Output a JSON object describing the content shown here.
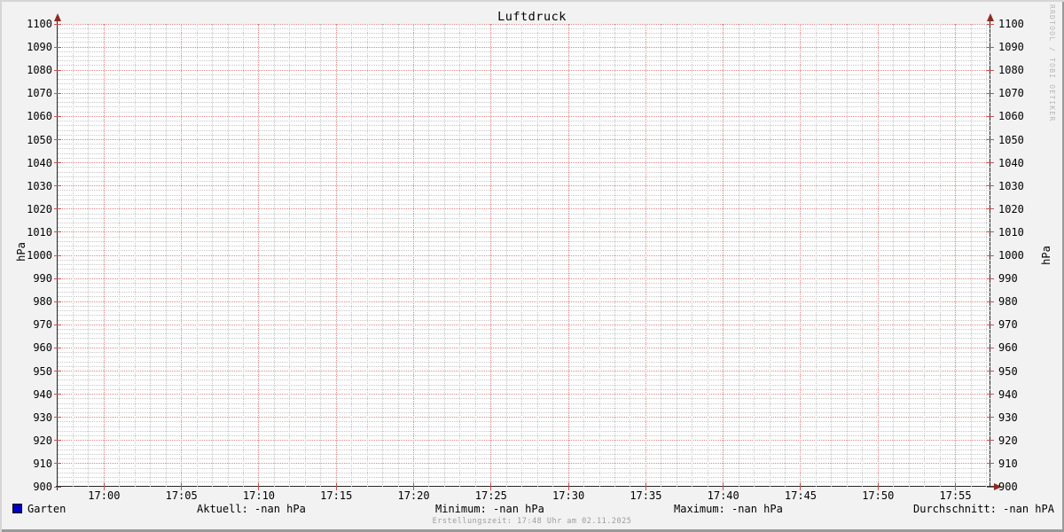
{
  "header": {
    "title": "Luftdruck"
  },
  "watermark": "RRDTOOL / TOBI OETIKER",
  "axes": {
    "left_unit": "hPa",
    "right_unit": "hPa"
  },
  "legend": {
    "series": {
      "label": "Garten",
      "color": "#0000c8"
    },
    "stats": [
      {
        "text": "Aktuell: -nan hPa"
      },
      {
        "text": "Minimum: -nan hPa"
      },
      {
        "text": "Maximum: -nan hPa"
      },
      {
        "text": "Durchschnitt: -nan hPA"
      }
    ]
  },
  "footer": {
    "text": "Erstellungszeit: 17:48 Uhr am 02.11.2025"
  },
  "chart_data": {
    "type": "line",
    "title": "Luftdruck",
    "xlabel": "",
    "ylabel": "hPa",
    "ylabel_right": "hPa",
    "ylim": [
      900,
      1100
    ],
    "y_major_step": 10,
    "y_minor_step": 2,
    "y_tick_labels": [
      "1100",
      "1090",
      "1080",
      "1070",
      "1060",
      "1050",
      "1040",
      "1030",
      "1020",
      "1010",
      "1000",
      "990",
      "980",
      "970",
      "960",
      "950",
      "940",
      "930",
      "920",
      "910",
      "900"
    ],
    "x_tick_labels": [
      "17:00",
      "17:05",
      "17:10",
      "17:15",
      "17:20",
      "17:25",
      "17:30",
      "17:35",
      "17:40",
      "17:45",
      "17:50",
      "17:55"
    ],
    "x_axis_start": "16:57",
    "x_major_step_min": 5,
    "x_minor_step_min": 1,
    "grid": true,
    "legend_position": "bottom",
    "series": [
      {
        "name": "Garten",
        "color": "#0000c8",
        "values": [],
        "stats": {
          "aktuell": "-nan hPa",
          "minimum": "-nan hPa",
          "maximum": "-nan hPa",
          "durchschnitt": "-nan hPA"
        }
      }
    ],
    "colors": {
      "background": "#f2f2f2",
      "canvas": "#ffffff",
      "major_grid": "#e08484",
      "minor_grid": "#c6c6c6",
      "major_tick": "#c85050",
      "axis": "#262626",
      "arrow": "#8e2a24",
      "font": "#000000",
      "footer_text": "#9c9c9c",
      "watermark_text": "#b8b8b8",
      "shade_light": "#d6d6d6",
      "shade_dark": "#9a9a9a"
    }
  }
}
